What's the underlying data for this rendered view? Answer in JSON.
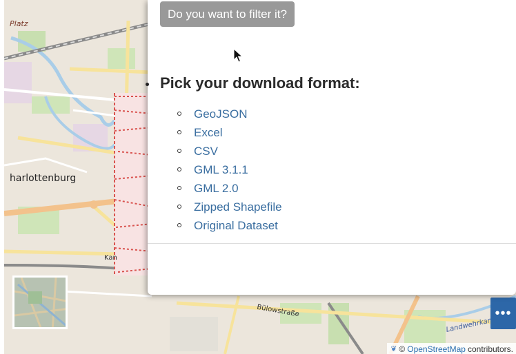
{
  "map": {
    "labels": {
      "platz": "Platz",
      "charlottenburg": "harlottenburg",
      "kan": "Kan",
      "bulowstrasse": "Bülowstraße",
      "landwehrkanal": "Landwehrkanal"
    },
    "attribution": {
      "prefix": "©",
      "link": "OpenStreetMap",
      "suffix": "contributors."
    },
    "more_button_label": "•••"
  },
  "panel": {
    "filter_button_label": "Do you want to filter it?",
    "download_title": "Pick your download format:",
    "formats": [
      "GeoJSON",
      "Excel",
      "CSV",
      "GML 3.1.1",
      "GML 2.0",
      "Zipped Shapefile",
      "Original Dataset"
    ]
  },
  "colors": {
    "link": "#3a6ea0",
    "filter_button": "#999999",
    "more_button": "#2d67a8",
    "map_base": "#ece6dc",
    "highlight_area": "#d9534f"
  },
  "icons": {
    "cursor": "arrow-cursor-icon",
    "attribution": "leaflet-icon",
    "more": "more-dots-icon"
  }
}
